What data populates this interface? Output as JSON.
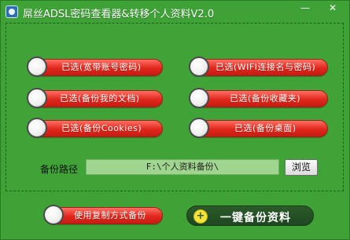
{
  "window": {
    "title": "屌丝ADSL密码查看器&转移个人资料V2.0",
    "min_glyph": "—",
    "close_glyph": "✕"
  },
  "options": [
    {
      "label": "已选(宽带账号密码)"
    },
    {
      "label": "已选(WIFI连接名与密码)"
    },
    {
      "label": "已选(备份我的文档)"
    },
    {
      "label": "已选(备份收藏夹)"
    },
    {
      "label": "已选(备份Cookies)"
    },
    {
      "label": "已选(备份桌面)"
    },
    {
      "label": "使用复制方式备份"
    }
  ],
  "backup_path": {
    "label": "备份路径",
    "value": "F:\\个人资料备份\\",
    "browse_label": "浏览"
  },
  "actions": {
    "backup_label": "一键备份资料",
    "backup_icon": "plus-icon"
  },
  "colors": {
    "window_bg": "#3fa236",
    "option_red": "#e0271c",
    "path_field_bg": "#a0d58f",
    "backup_button_bg": "#214a22"
  }
}
